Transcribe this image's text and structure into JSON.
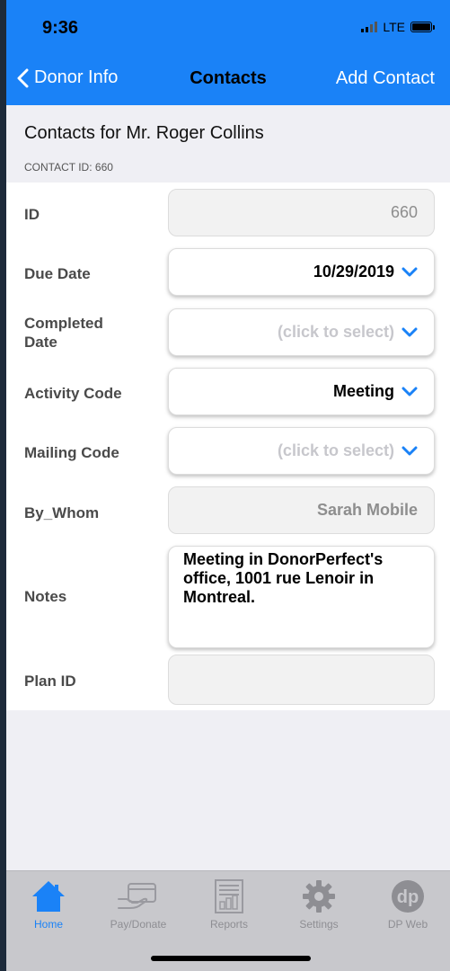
{
  "status_bar": {
    "time": "9:36",
    "network": "LTE"
  },
  "nav": {
    "back_label": "Donor Info",
    "title": "Contacts",
    "action_label": "Add Contact"
  },
  "subheader": {
    "title": "Contacts for Mr. Roger  Collins",
    "contact_id": "CONTACT ID: 660"
  },
  "form": {
    "id": {
      "label": "ID",
      "value": "660"
    },
    "due_date": {
      "label": "Due Date",
      "value": "10/29/2019"
    },
    "completed_date": {
      "label_line1": "Completed",
      "label_line2": "Date",
      "value": "(click to select)"
    },
    "activity_code": {
      "label": "Activity Code",
      "value": "Meeting"
    },
    "mailing_code": {
      "label": "Mailing Code",
      "value": "(click to select)"
    },
    "by_whom": {
      "label": "By_Whom",
      "value": "Sarah Mobile"
    },
    "notes": {
      "label": "Notes",
      "value": "Meeting in DonorPerfect's office, 1001 rue Lenoir in Montreal."
    },
    "plan_id": {
      "label": "Plan ID",
      "value": ""
    }
  },
  "tabs": [
    {
      "label": "Home",
      "icon": "home-icon",
      "active": true
    },
    {
      "label": "Pay/Donate",
      "icon": "credit-card-hand-icon",
      "active": false
    },
    {
      "label": "Reports",
      "icon": "report-icon",
      "active": false
    },
    {
      "label": "Settings",
      "icon": "gear-icon",
      "active": false
    },
    {
      "label": "DP Web",
      "icon": "dp-logo-icon",
      "active": false
    }
  ],
  "colors": {
    "accent": "#1a82f7",
    "tabbar": "#c8c8cc",
    "background": "#efeff4"
  }
}
